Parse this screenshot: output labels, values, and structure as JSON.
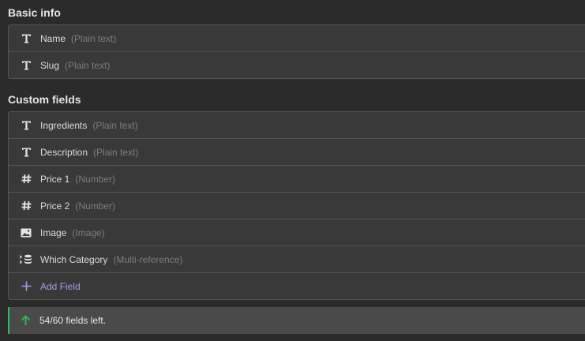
{
  "basic_info": {
    "title": "Basic info",
    "fields": [
      {
        "icon": "text-type-icon",
        "name": "Name",
        "type": "(Plain text)"
      },
      {
        "icon": "text-type-icon",
        "name": "Slug",
        "type": "(Plain text)"
      }
    ]
  },
  "custom_fields": {
    "title": "Custom fields",
    "fields": [
      {
        "icon": "text-type-icon",
        "name": "Ingredients",
        "type": "(Plain text)"
      },
      {
        "icon": "text-type-icon",
        "name": "Description",
        "type": "(Plain text)"
      },
      {
        "icon": "number-type-icon",
        "name": "Price 1",
        "type": "(Number)"
      },
      {
        "icon": "number-type-icon",
        "name": "Price 2",
        "type": "(Number)"
      },
      {
        "icon": "image-type-icon",
        "name": "Image",
        "type": "(Image)"
      },
      {
        "icon": "multi-reference-type-icon",
        "name": "Which Category",
        "type": "(Multi-reference)"
      }
    ],
    "add_field_label": "Add Field"
  },
  "status": {
    "text": "54/60 fields left.",
    "accent_color": "#2dbd5b"
  },
  "colors": {
    "add_accent": "#a59cf2"
  }
}
